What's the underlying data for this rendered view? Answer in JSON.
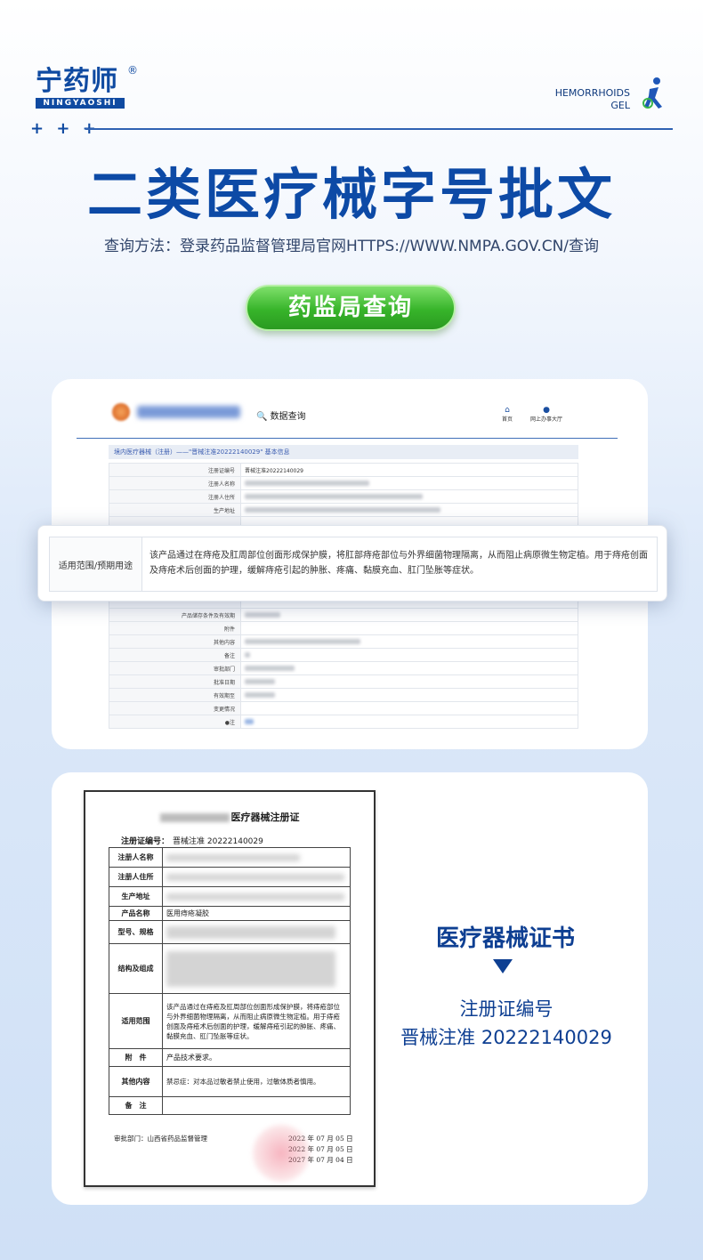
{
  "brand": {
    "logo_cn": "宁药师",
    "logo_reg": "®",
    "logo_en": "NINGYAOSHI",
    "plus_marks": "+ + +",
    "product_line1": "HEMORRHOIDS",
    "product_line2": "GEL"
  },
  "hero": {
    "title": "二类医疗械字号批文",
    "subtitle": "查询方法：登录药品监督管理局官网HTTPS://WWW.NMPA.GOV.CN/查询",
    "button_label": "药监局查询"
  },
  "website": {
    "search_label": "数据查询",
    "nav_home": "首页",
    "nav_hall": "网上办事大厅",
    "breadcrumb": "境内医疗器械（注册）——\"晋械注准20222140029\" 基本信息",
    "rows": [
      {
        "key": "注册证编号",
        "value": "晋械注准20222140029"
      },
      {
        "key": "注册人名称",
        "value": ""
      },
      {
        "key": "注册人住所",
        "value": ""
      },
      {
        "key": "生产地址",
        "value": ""
      },
      {
        "key": "产品储存条件及有效期",
        "value": ""
      },
      {
        "key": "附件",
        "value": ""
      },
      {
        "key": "其他内容",
        "value": ""
      },
      {
        "key": "备注",
        "value": ""
      },
      {
        "key": "审批部门",
        "value": ""
      },
      {
        "key": "批准日期",
        "value": ""
      },
      {
        "key": "有效期至",
        "value": ""
      },
      {
        "key": "变更情况",
        "value": ""
      },
      {
        "key": "●注",
        "value": ""
      }
    ],
    "highlight_key": "适用范围/预期用途",
    "highlight_value": "该产品通过在痔疮及肛周部位创面形成保护膜，将肛部痔疮部位与外界细菌物理隔离，从而阻止病原微生物定植。用于痔疮创面及痔疮术后创面的护理，缓解痔疮引起的肿胀、疼痛、黏膜充血、肛门坠胀等症状。"
  },
  "certificate": {
    "title_suffix": "医疗器械注册证",
    "no_label": "注册证编号：",
    "no_value": "晋械注准 20222140029",
    "rows": [
      {
        "key": "注册人名称",
        "value": ""
      },
      {
        "key": "注册人住所",
        "value": ""
      },
      {
        "key": "生产地址",
        "value": ""
      },
      {
        "key": "产品名称",
        "value": "医用痔疮凝胶"
      },
      {
        "key": "型号、规格",
        "value": ""
      },
      {
        "key": "结构及组成",
        "value": ""
      },
      {
        "key": "适用范围",
        "value": "该产品通过在痔疮及肛周部位创面形成保护膜，将痔疮部位与外界细菌物理隔离，从而阻止病原微生物定植。用于痔疮创面及痔疮术后创面的护理，缓解痔疮引起的肿胀、疼痛、黏膜充血、肛门坠胀等症状。"
      },
      {
        "key": "附　件",
        "value": "产品技术要求。"
      },
      {
        "key": "其他内容",
        "value": "禁忌症：对本品过敏者禁止使用，过敏体质者慎用。"
      },
      {
        "key": "备　注",
        "value": ""
      }
    ],
    "approval_line": "审批部门：山西省药品监督管理",
    "date1": "2022 年 07 月 05 日",
    "date2": "2022 年 07 月 05 日",
    "date3": "2027 年 07 月 04 日"
  },
  "cert_caption": {
    "title": "医疗器械证书",
    "label": "注册证编号",
    "value": "晋械注准 20222140029"
  },
  "colors": {
    "brand_blue": "#0d4aa6",
    "button_green": "#37b42a"
  }
}
